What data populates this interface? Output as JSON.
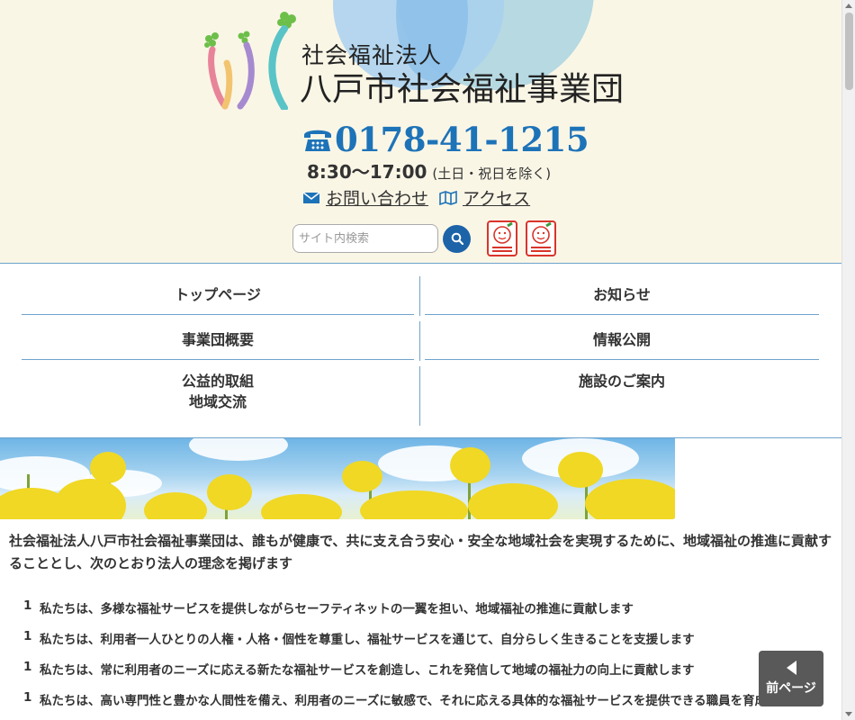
{
  "header": {
    "org_type": "社会福祉法人",
    "org_name": "八戸市社会福祉事業団",
    "phone": "0178-41-1215",
    "hours": "8:30〜17:00",
    "hours_note": "(土日・祝日を除く)",
    "contact_link": "お問い合わせ",
    "access_link": "アクセス",
    "search_placeholder": "サイト内検索"
  },
  "nav": {
    "top": "トップページ",
    "news": "お知らせ",
    "overview": "事業団概要",
    "disclosure": "情報公開",
    "public_1": "公益的取組",
    "public_2": "地域交流",
    "facilities": "施設のご案内"
  },
  "content": {
    "intro": "社会福祉法人八戸市社会福祉事業団は、誰もが健康で、共に支え合う安心・安全な地域社会を実現するために、地域福祉の推進に貢献することとし、次のとおり法人の理念を掲げます",
    "principles": [
      {
        "num": "1",
        "text": "私たちは、多様な福祉サービスを提供しながらセーフティネットの一翼を担い、地域福祉の推進に貢献します"
      },
      {
        "num": "1",
        "text": "私たちは、利用者一人ひとりの人権・人格・個性を尊重し、福祉サービスを通じて、自分らしく生きることを支援します"
      },
      {
        "num": "1",
        "text": "私たちは、常に利用者のニーズに応える新たな福祉サービスを創造し、これを発信して地域の福祉力の向上に貢献します"
      },
      {
        "num": "1",
        "text": "私たちは、高い専門性と豊かな人間性を備え、利用者のニーズに敏感で、それに応える具体的な福祉サービスを提供できる職員を育成します"
      }
    ]
  },
  "prev_button": "前ページ",
  "colors": {
    "header_bg": "#faf6e6",
    "accent_blue": "#1d73b8",
    "divider": "#6fa3cc",
    "badge_red": "#d9342b"
  },
  "icons": [
    "phone-icon",
    "mail-icon",
    "map-icon",
    "search-icon",
    "certification-badge-icon",
    "left-arrow-icon"
  ]
}
